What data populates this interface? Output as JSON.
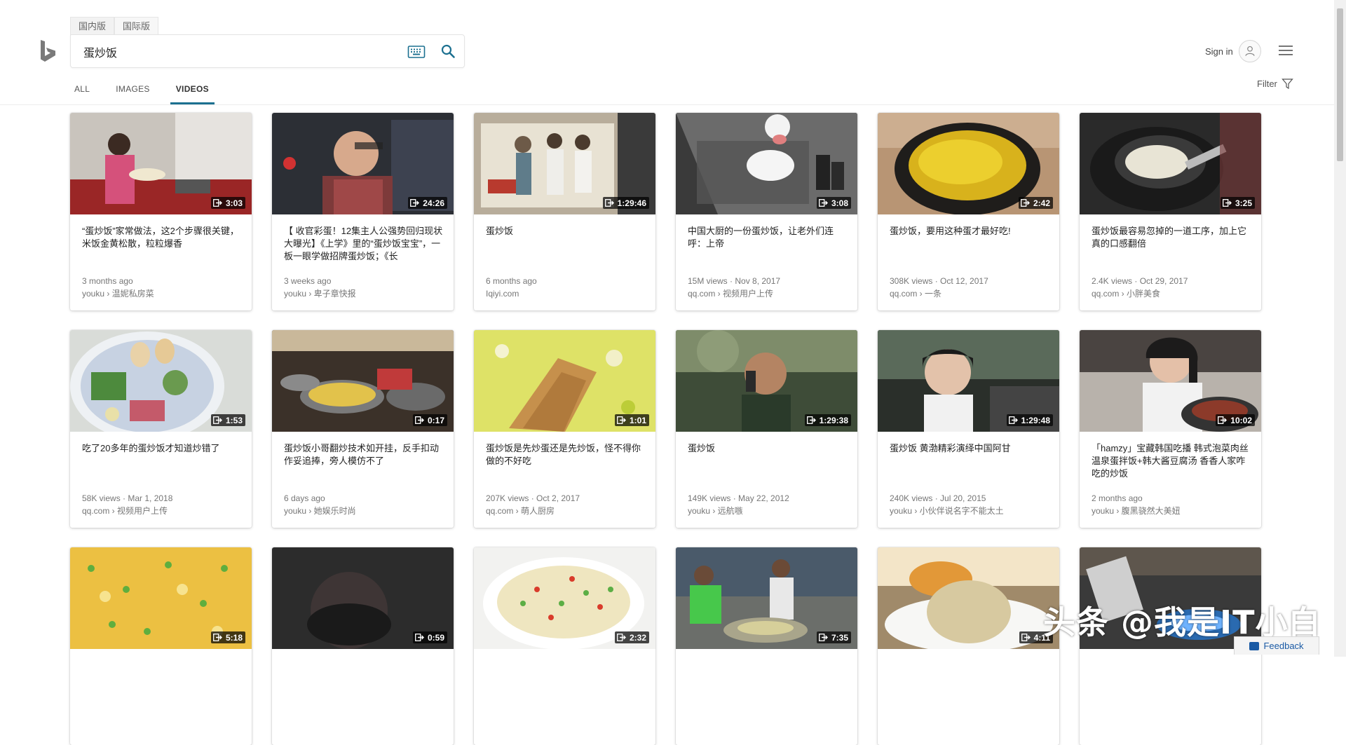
{
  "header": {
    "region_tabs": [
      "国内版",
      "国际版"
    ],
    "search_query": "蛋炒饭",
    "signin_label": "Sign in",
    "scope_tabs": [
      "ALL",
      "IMAGES",
      "VIDEOS"
    ],
    "active_scope": "VIDEOS",
    "filter_label": "Filter"
  },
  "colors": {
    "accent": "#1c7090"
  },
  "videos": [
    {
      "title": "“蛋炒饭”家常做法，这2个步骤很关键，米饭金黄松散，粒粒爆香",
      "duration": "3:03",
      "meta": "3 months ago",
      "source": "youku › 温妮私房菜"
    },
    {
      "title": "【 收官彩蛋！12集主人公强势回归现状大曝光】《上学》里的“蛋炒饭宝宝”，一板一眼学做招牌蛋炒饭；《长",
      "duration": "24:26",
      "meta": "3 weeks ago",
      "source": "youku › 卑子章快报"
    },
    {
      "title": "蛋炒饭",
      "duration": "1:29:46",
      "meta": "6 months ago",
      "source": "Iqiyi.com"
    },
    {
      "title": "中国大厨的一份蛋炒饭，让老外们连呼：上帝",
      "duration": "3:08",
      "meta": "15M views · Nov 8, 2017",
      "source": "qq.com › 视频用户上传"
    },
    {
      "title": "蛋炒饭，要用这种蛋才最好吃!",
      "duration": "2:42",
      "meta": "308K views · Oct 12, 2017",
      "source": "qq.com › 一条"
    },
    {
      "title": "蛋炒饭最容易忽掉的一道工序，加上它真的口感翻倍",
      "duration": "3:25",
      "meta": "2.4K views · Oct 29, 2017",
      "source": "qq.com › 小胖美食"
    },
    {
      "title": "吃了20多年的蛋炒饭才知道炒错了",
      "duration": "1:53",
      "meta": "58K views · Mar 1, 2018",
      "source": "qq.com › 视频用户上传"
    },
    {
      "title": "蛋炒饭小哥翻炒技术如开挂，反手扣动作妥追捧，旁人模仿不了",
      "duration": "0:17",
      "meta": "6 days ago",
      "source": "youku › 她娱乐时尚"
    },
    {
      "title": "蛋炒饭是先炒蛋还是先炒饭，怪不得你做的不好吃",
      "duration": "1:01",
      "meta": "207K views · Oct 2, 2017",
      "source": "qq.com › 萌人厨房"
    },
    {
      "title": "蛋炒饭",
      "duration": "1:29:38",
      "meta": "149K views · May 22, 2012",
      "source": "youku › 远航嗾"
    },
    {
      "title": "蛋炒饭 黄渤精彩演绎中国阿甘",
      "duration": "1:29:48",
      "meta": "240K views · Jul 20, 2015",
      "source": "youku › 小伙伴说名字不能太土"
    },
    {
      "title": "「hamzy」宝藏韩国吃播 韩式泡菜肉丝温泉蛋拌饭+韩大酱豆腐汤 香香人家咋吃的炒饭",
      "duration": "10:02",
      "meta": "2 months ago",
      "source": "youku › 腹黑骁然大美妞"
    },
    {
      "title": "",
      "duration": "5:18",
      "meta": "",
      "source": ""
    },
    {
      "title": "",
      "duration": "0:59",
      "meta": "",
      "source": ""
    },
    {
      "title": "",
      "duration": "2:32",
      "meta": "",
      "source": ""
    },
    {
      "title": "",
      "duration": "7:35",
      "meta": "",
      "source": ""
    },
    {
      "title": "",
      "duration": "4:11",
      "meta": "",
      "source": ""
    },
    {
      "title": "",
      "duration": "",
      "meta": "",
      "source": ""
    }
  ],
  "overlays": {
    "watermark": "头条 @我是IT小白",
    "feedback_label": "Feedback"
  }
}
